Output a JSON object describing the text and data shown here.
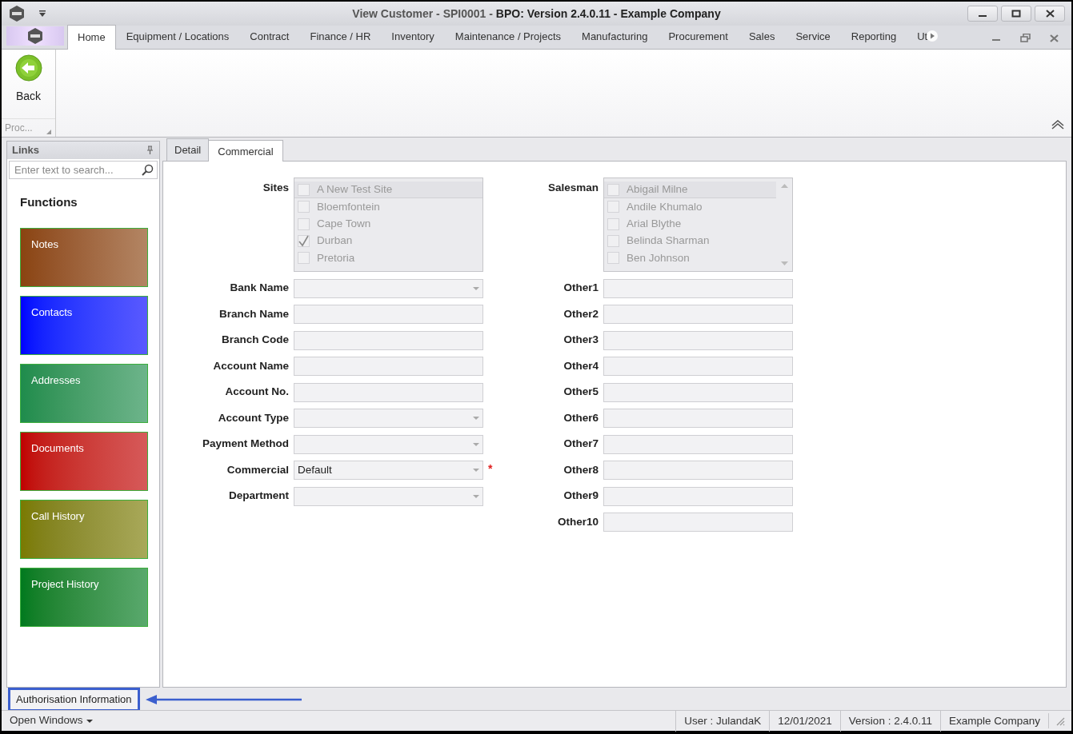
{
  "window": {
    "title_prefix": "View Customer - SPI0001 - ",
    "title_bold": "BPO: Version 2.4.0.11 - Example Company"
  },
  "ribbon": {
    "tabs": [
      {
        "label": "Home",
        "selected": true
      },
      {
        "label": "Equipment / Locations",
        "selected": false
      },
      {
        "label": "Contract",
        "selected": false
      },
      {
        "label": "Finance / HR",
        "selected": false
      },
      {
        "label": "Inventory",
        "selected": false
      },
      {
        "label": "Maintenance / Projects",
        "selected": false
      },
      {
        "label": "Manufacturing",
        "selected": false
      },
      {
        "label": "Procurement",
        "selected": false
      },
      {
        "label": "Sales",
        "selected": false
      },
      {
        "label": "Service",
        "selected": false
      },
      {
        "label": "Reporting",
        "selected": false
      },
      {
        "label": "Ut",
        "selected": false
      }
    ],
    "buttons": [
      {
        "label": "Back"
      }
    ],
    "group_label": "Proc..."
  },
  "links_panel": {
    "title": "Links",
    "search": {
      "placeholder": "Enter text to search..."
    },
    "heading": "Functions",
    "tiles": [
      {
        "label": "Notes",
        "color": "#8a4410"
      },
      {
        "label": "Contacts",
        "color": "#0000ff"
      },
      {
        "label": "Addresses",
        "color": "#1e8c4c"
      },
      {
        "label": "Documents",
        "color": "#c00000"
      },
      {
        "label": "Call History",
        "color": "#7a7a00"
      },
      {
        "label": "Project History",
        "color": "#007a1e"
      }
    ]
  },
  "tabs": [
    {
      "label": "Detail",
      "selected": false
    },
    {
      "label": "Commercial",
      "selected": true
    }
  ],
  "left_fields": [
    {
      "label": "Sites",
      "kind": "checklist",
      "scrollbar": false,
      "items": [
        {
          "label": "A New Test Site",
          "checked": false
        },
        {
          "label": "Bloemfontein",
          "checked": false
        },
        {
          "label": "Cape Town",
          "checked": false
        },
        {
          "label": "Durban",
          "checked": true
        },
        {
          "label": "Pretoria",
          "checked": false
        }
      ]
    },
    {
      "label": "Bank Name",
      "kind": "combo"
    },
    {
      "label": "Branch Name",
      "kind": "text"
    },
    {
      "label": "Branch Code",
      "kind": "text"
    },
    {
      "label": "Account Name",
      "kind": "text"
    },
    {
      "label": "Account No.",
      "kind": "text"
    },
    {
      "label": "Account Type",
      "kind": "combo"
    },
    {
      "label": "Payment Method",
      "kind": "combo"
    },
    {
      "label": "Commercial",
      "kind": "combo",
      "value": "Default",
      "required_mark": "*"
    },
    {
      "label": "Department",
      "kind": "combo"
    }
  ],
  "right_fields": [
    {
      "label": "Salesman",
      "kind": "checklist",
      "scrollbar": true,
      "items": [
        {
          "label": "Abigail Milne",
          "checked": false
        },
        {
          "label": "Andile Khumalo",
          "checked": false
        },
        {
          "label": "Arial Blythe",
          "checked": false
        },
        {
          "label": "Belinda Sharman",
          "checked": false
        },
        {
          "label": "Ben Johnson",
          "checked": false
        }
      ]
    },
    {
      "label": "Other1",
      "kind": "text"
    },
    {
      "label": "Other2",
      "kind": "text"
    },
    {
      "label": "Other3",
      "kind": "text"
    },
    {
      "label": "Other4",
      "kind": "text"
    },
    {
      "label": "Other5",
      "kind": "text"
    },
    {
      "label": "Other6",
      "kind": "text"
    },
    {
      "label": "Other7",
      "kind": "text"
    },
    {
      "label": "Other8",
      "kind": "text"
    },
    {
      "label": "Other9",
      "kind": "text"
    },
    {
      "label": "Other10",
      "kind": "text"
    }
  ],
  "authorisation": {
    "label": "Authorisation Information",
    "highlighted": true
  },
  "status_bar": {
    "open_windows": "Open Windows",
    "items": [
      "User : JulandaK",
      "12/01/2021",
      "Version : 2.4.0.11",
      "Example Company"
    ]
  }
}
